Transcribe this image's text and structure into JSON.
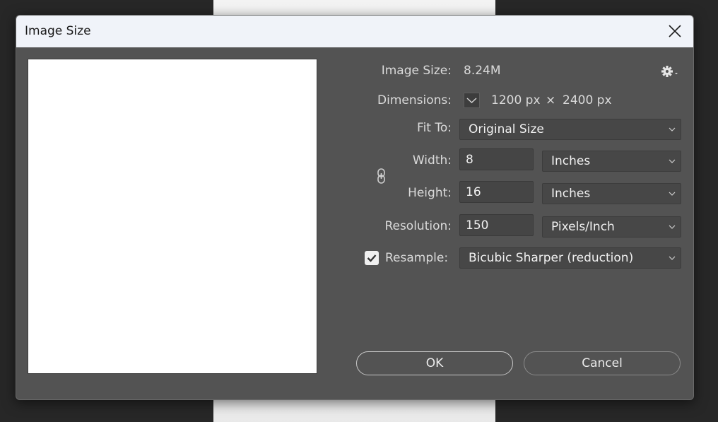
{
  "dialog": {
    "title": "Image Size"
  },
  "info": {
    "image_size_label": "Image Size:",
    "image_size_value": "8.24M",
    "dimensions_label": "Dimensions:",
    "dim_width": "1200 px",
    "dim_times": "×",
    "dim_height": "2400 px"
  },
  "fit_to": {
    "label": "Fit To:",
    "value": "Original Size"
  },
  "width": {
    "label": "Width:",
    "value": "8",
    "unit": "Inches"
  },
  "height": {
    "label": "Height:",
    "value": "16",
    "unit": "Inches"
  },
  "resolution": {
    "label": "Resolution:",
    "value": "150",
    "unit": "Pixels/Inch"
  },
  "resample": {
    "label": "Resample:",
    "checked": true,
    "value": "Bicubic Sharper (reduction)"
  },
  "buttons": {
    "ok": "OK",
    "cancel": "Cancel"
  },
  "icons": {
    "close": "close-icon",
    "gear": "gear-icon",
    "link": "link-chain-icon",
    "chevron": "chevron-down-icon",
    "checkmark": "checkmark-icon"
  },
  "colors": {
    "dialog_bg": "#535353",
    "titlebar_bg": "#f0f3f9",
    "field_bg": "#454545",
    "text": "#dadada"
  }
}
